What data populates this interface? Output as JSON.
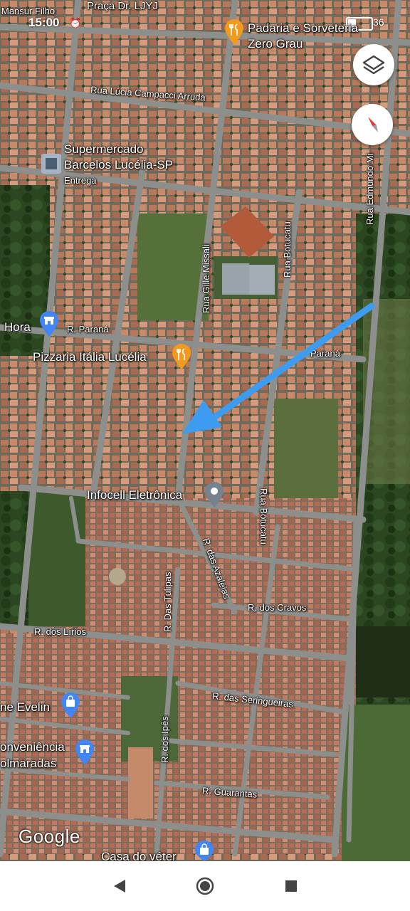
{
  "status_bar": {
    "time": "15:00",
    "alarm_icon": "alarm-icon",
    "battery_percent": "36",
    "battery_level": 0.36
  },
  "map": {
    "roads": {
      "mansur": "Mansur Filho",
      "praca": "Praça Dr. LJYJ",
      "lucia": "Rua Lúcia Campacci Arruda",
      "edmundo": "Rua Edmundo Mi",
      "gille": "Rua Gille Missali",
      "botucatu_top": "Rua Botucatu",
      "parana_left": "R. Paraná",
      "parana_right": "Paraná",
      "botucatu_bottom": "Rua Botucatu",
      "azaleias": "R. das Azaléias",
      "tulipas": "R. Das Tulipas",
      "cravos": "R. dos Cravos",
      "lirios": "R. dos Lírios",
      "seringueiras": "R. das Seringueiras",
      "ipes": "R. dos Ipês",
      "guarantas": "R. Guarantas"
    },
    "pois": {
      "padaria": {
        "line1": "Padaria e Sorveteria",
        "line2": "Zero Grau",
        "icon": "restaurant-pin-icon"
      },
      "supermercado": {
        "line1": "Supermercado",
        "line2": "Barcelos Lucélia-SP",
        "sub": "Entrega",
        "icon": "store-icon"
      },
      "hora": {
        "label": "Hora",
        "icon": "shop-pin-icon"
      },
      "pizzaria": {
        "label": "Pizzaria Itália Lucélia",
        "icon": "restaurant-pin-icon"
      },
      "infocell": {
        "label": "Infocell Eletrônica",
        "icon": "place-pin-icon"
      },
      "evelin": {
        "label": "ne Evelin",
        "icon": "shopping-bag-pin-icon"
      },
      "conveniencia": {
        "line1": "onveniência",
        "line2": "olmaradas",
        "icon": "shop-pin-icon"
      },
      "casa": {
        "label": "Casa do véter",
        "icon": "shopping-bag-pin-icon"
      }
    },
    "attribution": "Google"
  },
  "controls": {
    "layers_icon": "layers-icon",
    "compass_icon": "compass-icon"
  },
  "annotation": {
    "arrow_icon": "blue-arrow-icon",
    "color": "#3d9cf0"
  },
  "nav_bar": {
    "back_icon": "back-triangle-icon",
    "home_icon": "home-circle-icon",
    "recents_icon": "recents-square-icon"
  }
}
